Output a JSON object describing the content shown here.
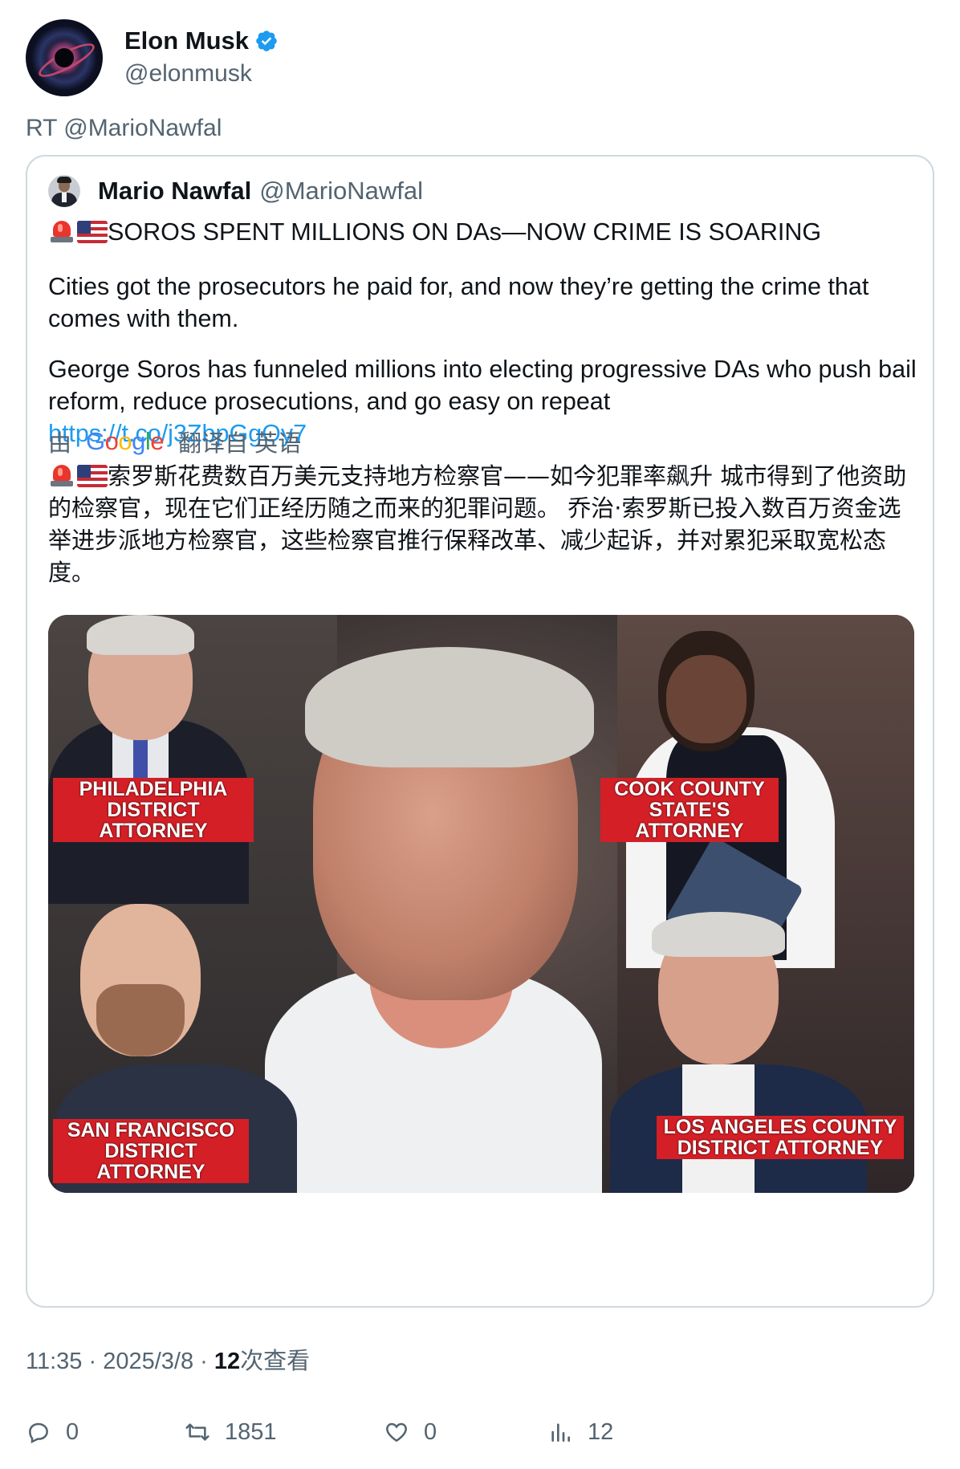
{
  "author": {
    "name": "Elon Musk",
    "handle": "@elonmusk",
    "verified": true
  },
  "retweet_line": "RT @MarioNawfal",
  "quoted": {
    "name": "Mario Nawfal",
    "handle": "@MarioNawfal",
    "headline": "SOROS SPENT MILLIONS ON DAs—NOW CRIME IS SOARING",
    "paragraph1": "Cities got the prosecutors he paid for, and now they’re getting the crime that comes with them.",
    "paragraph2": "George Soros has funneled millions into electing progressive DAs who push bail reform, reduce prosecutions, and go easy on repeat",
    "link": "https://t.co/j3ZbpGgOy7",
    "translation": {
      "prefix": "由",
      "provider": "Google",
      "suffix": "翻译自 英语",
      "text": "索罗斯花费数百万美元支持地方检察官——如今犯罪率飙升 城市得到了他资助的检察官，现在它们正经历随之而来的犯罪问题。 乔治·索罗斯已投入数百万资金选举进步派地方检察官，这些检察官推行保释改革、减少起诉，并对累犯采取宽松态度。"
    },
    "image_labels": {
      "philadelphia_line1": "PHILADELPHIA",
      "philadelphia_line2": "DISTRICT ATTORNEY",
      "cook_line1": "COOK COUNTY",
      "cook_line2": "STATE'S ATTORNEY",
      "sf_line1": "SAN FRANCISCO",
      "sf_line2": "DISTRICT ATTORNEY",
      "la_line1": "LOS ANGELES COUNTY",
      "la_line2": "DISTRICT ATTORNEY"
    }
  },
  "meta": {
    "time": "11:35",
    "date": "2025/3/8",
    "views_count": "12",
    "views_label": "次查看",
    "separator": "·"
  },
  "actions": {
    "replies": "0",
    "retweets": "1851",
    "likes": "0",
    "views": "12"
  },
  "colors": {
    "link": "#1d9bf0",
    "secondary_text": "#536471",
    "border": "#cfd9de",
    "label_red": "#d41f26"
  }
}
